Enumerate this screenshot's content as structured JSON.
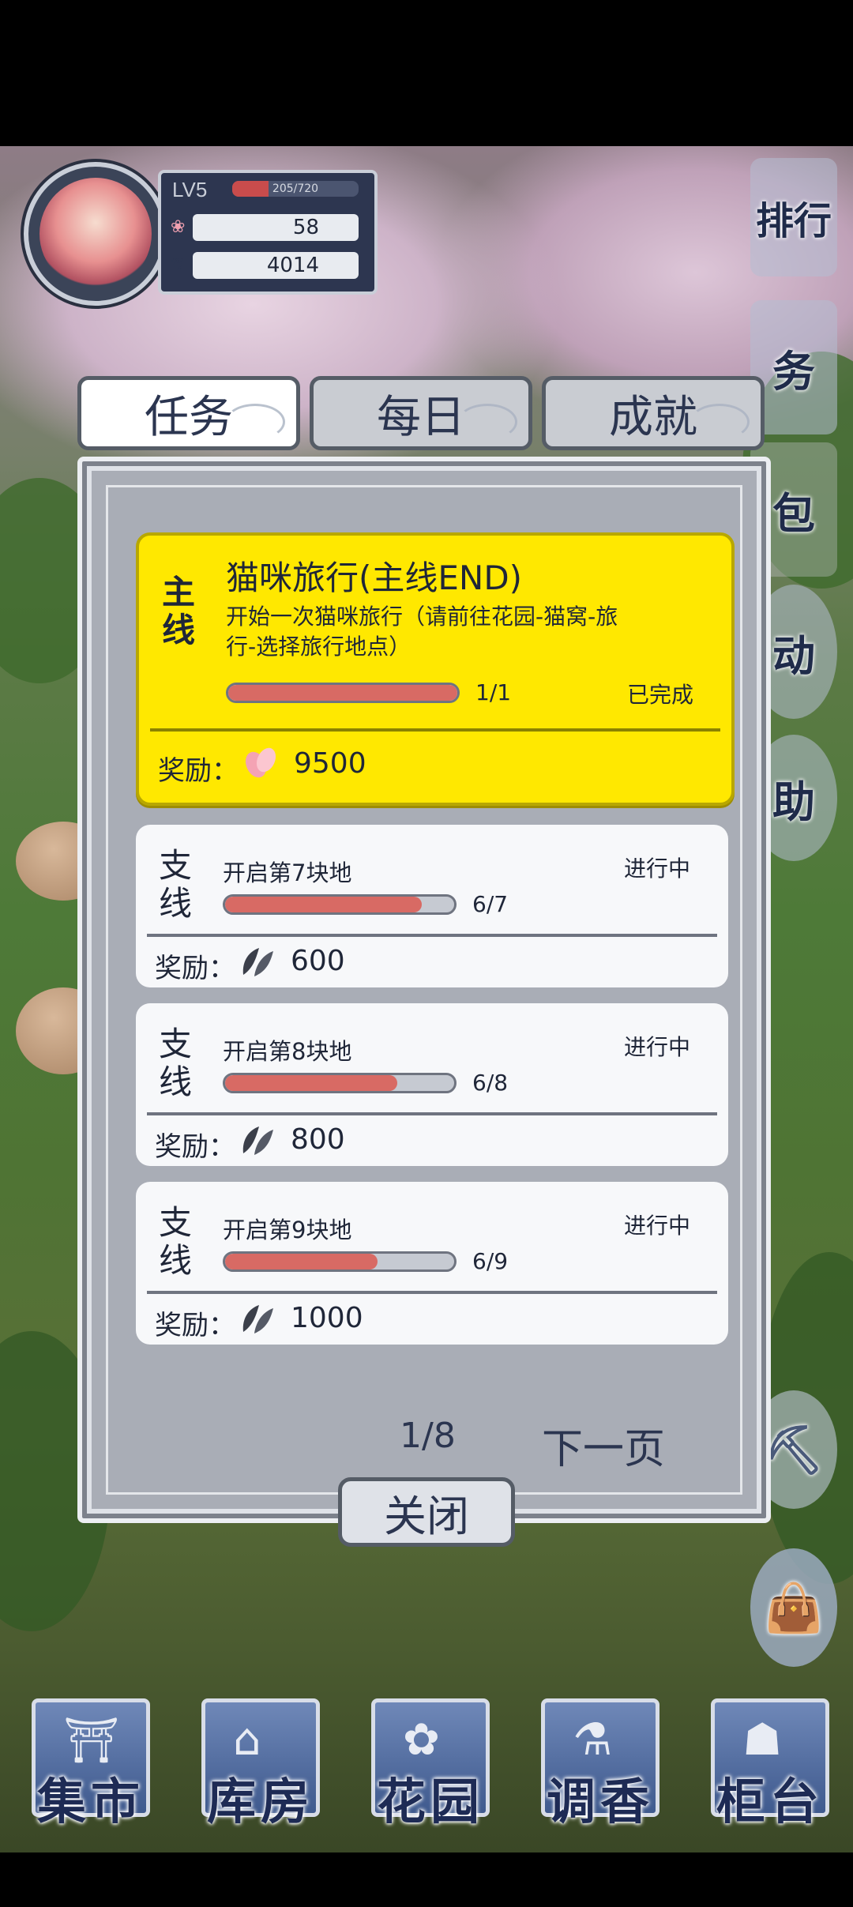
{
  "player": {
    "level": "LV5",
    "xp_text": "205/720",
    "xp_fraction": 0.285,
    "petals": "58",
    "leaves": "4014"
  },
  "side_buttons": {
    "ranking": "排行",
    "task": "务",
    "bag": "包",
    "event": "动",
    "help": "助"
  },
  "tabs": [
    {
      "label": "任务",
      "active": true
    },
    {
      "label": "每日",
      "active": false
    },
    {
      "label": "成就",
      "active": false
    }
  ],
  "quests": [
    {
      "type": "主线",
      "title": "猫咪旅行(主线END)",
      "description": "开始一次猫咪旅行（请前往花园-猫窝-旅行-选择旅行地点）",
      "progress_text": "1/1",
      "progress_fraction": 1.0,
      "status": "已完成",
      "reward_label": "奖励：",
      "reward_icon": "petal-icon",
      "reward_value": "9500"
    },
    {
      "type": "支线",
      "title": "开启第7块地",
      "progress_text": "6/7",
      "progress_fraction": 0.857,
      "status": "进行中",
      "reward_label": "奖励：",
      "reward_icon": "leaf-icon",
      "reward_value": "600"
    },
    {
      "type": "支线",
      "title": "开启第8块地",
      "progress_text": "6/8",
      "progress_fraction": 0.75,
      "status": "进行中",
      "reward_label": "奖励：",
      "reward_icon": "leaf-icon",
      "reward_value": "800"
    },
    {
      "type": "支线",
      "title": "开启第9块地",
      "progress_text": "6/9",
      "progress_fraction": 0.667,
      "status": "进行中",
      "reward_label": "奖励：",
      "reward_icon": "leaf-icon",
      "reward_value": "1000"
    }
  ],
  "pagination": {
    "page_text": "1/8",
    "next_label": "下一页"
  },
  "close_label": "关闭",
  "bottom_nav": [
    "集市",
    "库房",
    "花园",
    "调香",
    "柜台"
  ],
  "colors": {
    "main_card": "#ffe800",
    "progress_fill": "#d86a64",
    "accent_text": "#2b3550"
  }
}
